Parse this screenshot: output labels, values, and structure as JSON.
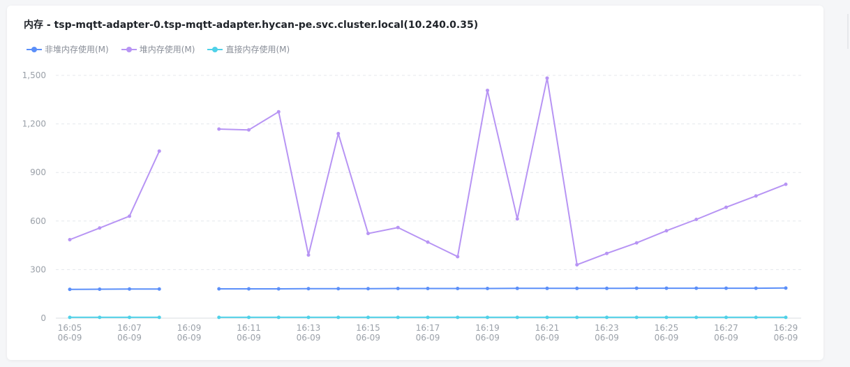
{
  "chart_data": {
    "type": "line",
    "title": "内存 - tsp-mqtt-adapter-0.tsp-mqtt-adapter.hycan-pe.svc.cluster.local(10.240.0.35)",
    "xlabel": "",
    "ylabel": "",
    "ylim": [
      0,
      1500
    ],
    "yticks": [
      "0",
      "300",
      "600",
      "900",
      "1,200",
      "1,500"
    ],
    "x_ticks": [
      {
        "time": "16:05",
        "date": "06-09"
      },
      {
        "time": "16:07",
        "date": "06-09"
      },
      {
        "time": "16:09",
        "date": "06-09"
      },
      {
        "time": "16:11",
        "date": "06-09"
      },
      {
        "time": "16:13",
        "date": "06-09"
      },
      {
        "time": "16:15",
        "date": "06-09"
      },
      {
        "time": "16:17",
        "date": "06-09"
      },
      {
        "time": "16:19",
        "date": "06-09"
      },
      {
        "time": "16:21",
        "date": "06-09"
      },
      {
        "time": "16:23",
        "date": "06-09"
      },
      {
        "time": "16:25",
        "date": "06-09"
      },
      {
        "time": "16:27",
        "date": "06-09"
      },
      {
        "time": "16:29",
        "date": "06-09"
      }
    ],
    "x": [
      "16:05",
      "16:06",
      "16:07",
      "16:08",
      "16:09",
      "16:10",
      "16:11",
      "16:12",
      "16:13",
      "16:14",
      "16:15",
      "16:16",
      "16:17",
      "16:18",
      "16:19",
      "16:20",
      "16:21",
      "16:22",
      "16:23",
      "16:24",
      "16:25",
      "16:26",
      "16:27",
      "16:28",
      "16:29"
    ],
    "grid": true,
    "legend_position": "top-left",
    "series": [
      {
        "name": "非堆内存使用(M)",
        "color": "#5b8ff9",
        "values": [
          178,
          179,
          180,
          180,
          null,
          181,
          181,
          181,
          182,
          182,
          182,
          183,
          183,
          183,
          183,
          184,
          184,
          184,
          184,
          185,
          185,
          185,
          185,
          185,
          186
        ]
      },
      {
        "name": "堆内存使用(M)",
        "color": "#b794f4",
        "values": [
          485,
          557,
          630,
          1032,
          null,
          1168,
          1163,
          1275,
          390,
          1140,
          523,
          560,
          470,
          380,
          1407,
          613,
          1483,
          330,
          400,
          465,
          540,
          610,
          685,
          755,
          827
        ]
      },
      {
        "name": "直接内存使用(M)",
        "color": "#4fd1e8",
        "values": [
          5,
          5,
          5,
          5,
          null,
          5,
          5,
          5,
          5,
          5,
          5,
          5,
          5,
          5,
          5,
          5,
          5,
          5,
          5,
          5,
          5,
          5,
          5,
          5,
          5
        ]
      }
    ]
  }
}
